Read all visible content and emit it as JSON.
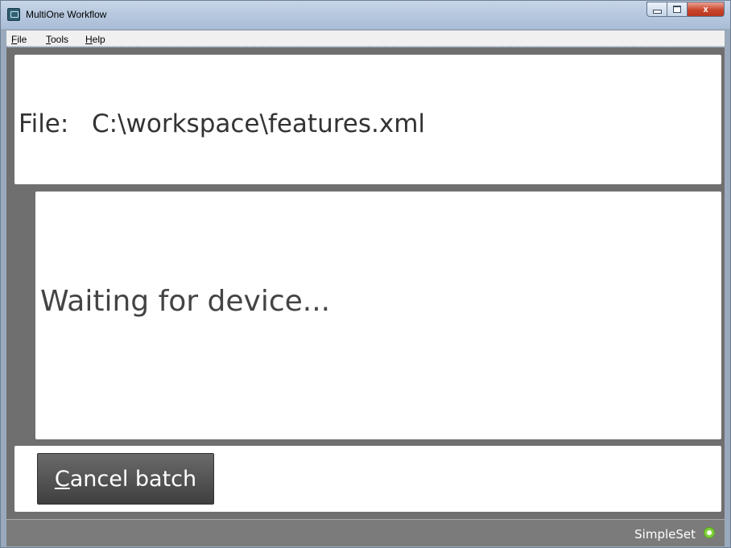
{
  "window": {
    "title": "MultiOne Workflow",
    "controls": {
      "close": "x"
    }
  },
  "menu": [
    {
      "mnemonic": "F",
      "rest": "ile"
    },
    {
      "mnemonic": "T",
      "rest": "ools"
    },
    {
      "mnemonic": "H",
      "rest": "elp"
    }
  ],
  "file_panel": {
    "label": "File:",
    "path": "C:\\workspace\\features.xml"
  },
  "status": {
    "message": "Waiting for device..."
  },
  "actions": {
    "cancel": {
      "mnemonic": "C",
      "rest": "ancel batch"
    }
  },
  "statusbar": {
    "mode": "SimpleSet",
    "indicator_color": "#7fd13a"
  }
}
